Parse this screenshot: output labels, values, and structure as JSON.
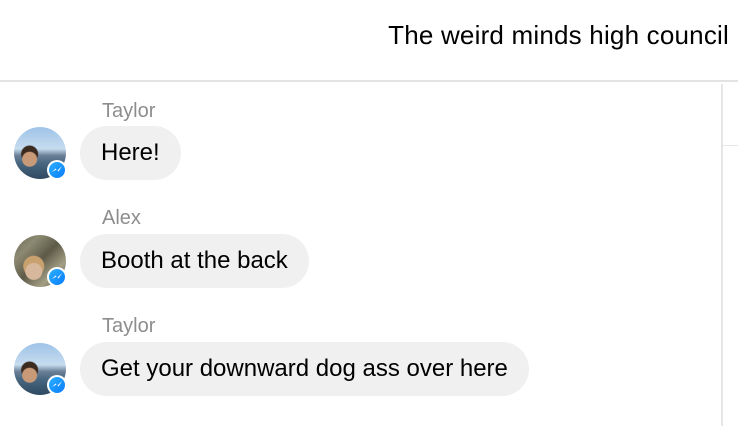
{
  "header": {
    "title": "The weird minds high council"
  },
  "messages": [
    {
      "sender": "Taylor",
      "text": "Here!",
      "avatar": "taylor-avatar"
    },
    {
      "sender": "Alex",
      "text": "Booth at the back",
      "avatar": "alex-avatar"
    },
    {
      "sender": "Taylor",
      "text": "Get your downward dog ass over here",
      "avatar": "taylor-avatar"
    }
  ],
  "colors": {
    "bubble": "#f1f0f0",
    "sender_name": "#8d8d8d",
    "messenger_badge": "#0a7cff"
  },
  "icons": {
    "badge": "messenger-icon"
  }
}
